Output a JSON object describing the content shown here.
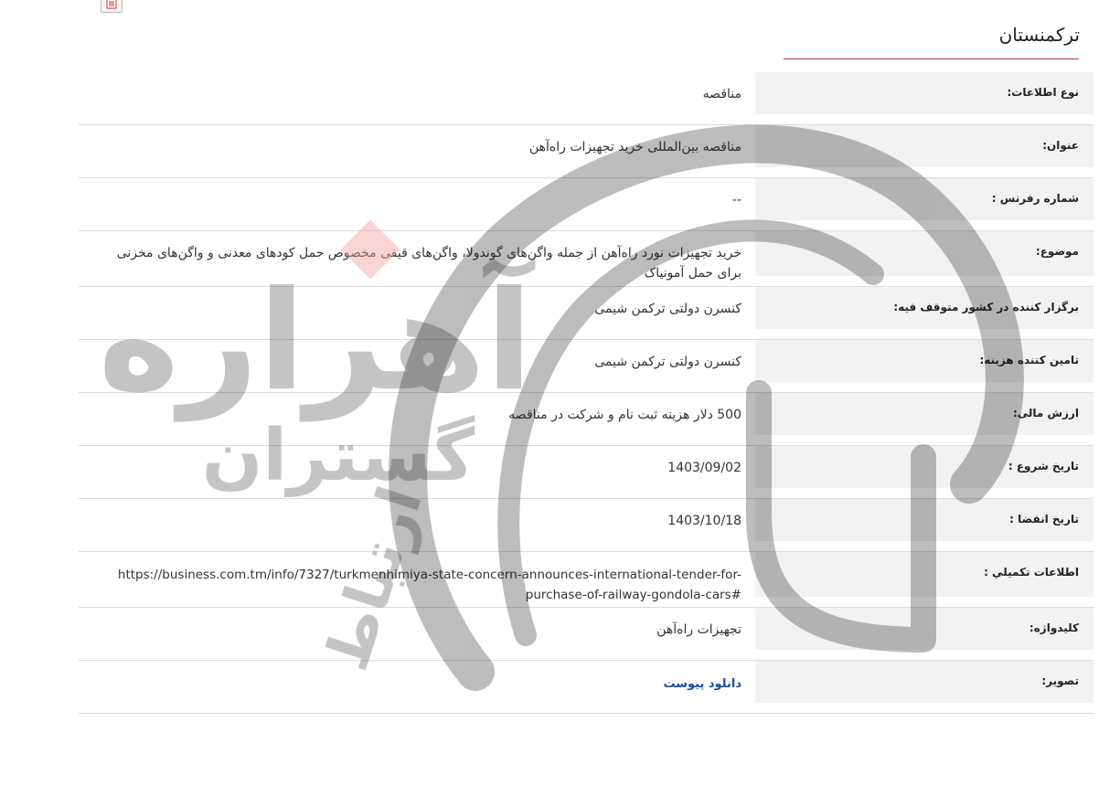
{
  "page": {
    "title": "ترکمنستان",
    "accent_color": "#c2287a"
  },
  "toolbar": {
    "print_icon": "print-icon"
  },
  "watermark": {
    "text_main": "آهراره",
    "text_sub": "گستران",
    "text_side": "ارتباط"
  },
  "details": [
    {
      "key": "info_type",
      "label": "نوع اطلاعات:",
      "value": "مناقصه"
    },
    {
      "key": "title",
      "label": "عنوان:",
      "value": "مناقصه بین‌المللی خرید تجهیزات راه‌آهن"
    },
    {
      "key": "reference",
      "label": "شماره رفرنس :",
      "value": "--"
    },
    {
      "key": "subject",
      "label": "موضوع:",
      "value": "خرید تجهیزات نورد راه‌آهن از جمله واگن‌های گوندولا، واگن‌های قیفی مخصوص حمل کودهای معدنی و واگن‌های مخزنی برای حمل آمونیاک"
    },
    {
      "key": "organizer",
      "label": "برگزار کننده در کشور متوقف فیه:",
      "value": "کنسرن دولتی ترکمن شیمی"
    },
    {
      "key": "funder",
      "label": "تامین کننده هزینه:",
      "value": "کنسرن دولتی ترکمن شیمی"
    },
    {
      "key": "financial_value",
      "label": "ارزش مالی:",
      "value": "500 دلار هزینه ثبت نام و شرکت در مناقصه"
    },
    {
      "key": "start_date",
      "label": "تاریخ شروع :",
      "value": "1403/09/02"
    },
    {
      "key": "expiry_date",
      "label": "تاریخ انقضا :",
      "value": "1403/10/18"
    },
    {
      "key": "more_info",
      "label": "اطلاعات تكميلي :",
      "value": "https://business.com.tm/info/7327/turkmenhimiya-state-concern-announces-international-tender-for-purchase-of-railway-gondola-cars#"
    },
    {
      "key": "keyword",
      "label": "کلیدواژه:",
      "value": "تجهیزات راه‌آهن"
    },
    {
      "key": "image",
      "label": "تصویر:",
      "value": "دانلود پیوست"
    }
  ]
}
